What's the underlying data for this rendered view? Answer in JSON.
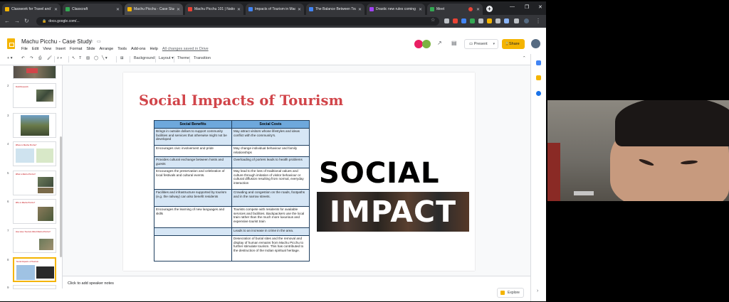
{
  "browser": {
    "tabs": [
      {
        "label": "Classwork for Travel and Tou",
        "color": "#f4b400"
      },
      {
        "label": "Classcraft",
        "color": "#34a853"
      },
      {
        "label": "Machu Picchu - Case Stud",
        "color": "#f4b400"
      },
      {
        "label": "Machu Picchu 101 | Nation",
        "color": "#ea4335"
      },
      {
        "label": "Impacts of Tourism in Machu",
        "color": "#4285f4"
      },
      {
        "label": "The Balance Between Touris",
        "color": "#4285f4"
      },
      {
        "label": "Drastic new rules coming fo",
        "color": "#a142f4"
      },
      {
        "label": "Meet",
        "color": "#34a853"
      }
    ],
    "new_tab": "+",
    "url": "docs.google.com/..."
  },
  "app": {
    "doc_title": "Machu Picchu - Case Study",
    "menu": [
      "File",
      "Edit",
      "View",
      "Insert",
      "Format",
      "Slide",
      "Arrange",
      "Tools",
      "Add-ons",
      "Help"
    ],
    "saved_status": "All changes saved in Drive",
    "present_label": "Present",
    "share_label": "Share",
    "toolbar": {
      "background": "Background",
      "layout": "Layout",
      "theme": "Theme",
      "transition": "Transition"
    }
  },
  "filmstrip": {
    "slides": [
      {
        "num": "",
        "title": ""
      },
      {
        "num": "2",
        "title": "Field Research"
      },
      {
        "num": "3",
        "title": ""
      },
      {
        "num": "4",
        "title": "Where is Machu Picchu?"
      },
      {
        "num": "5",
        "title": "What is Machu Picchu?"
      },
      {
        "num": "6",
        "title": "Who is Machu Picchu?"
      },
      {
        "num": "7",
        "title": "How does Tourism Affect Machu Picchu?"
      },
      {
        "num": "8",
        "title": "Social Impacts of Tourism"
      },
      {
        "num": "9",
        "title": ""
      }
    ],
    "selected": "8"
  },
  "slide": {
    "title": "Social Impacts of Tourism",
    "table": {
      "headers": [
        "Social Benefits",
        "Social Costs"
      ],
      "rows": [
        [
          "Brings in outside dollars to support community facilities and services that otherwise might not be developed",
          "May attract visitors whose lifestyles and ideas conflict with the community's."
        ],
        [
          "Encourages civic involvement and pride",
          "May change individual behaviour and family relationships"
        ],
        [
          "Provides cultural exchange between hosts and guests",
          "Overloading of porters leads to health problems"
        ],
        [
          "Encourages the preservation and celebration of local festivals and cultural events.",
          "May lead to the loss of traditional values and culture through imitation of visitor behaviour or cultural diffusion resulting from normal, everyday interaction"
        ],
        [
          "Facilities and infrastructure supported by tourism (e.g. the railway) can also benefit residents",
          "Crowding and congestion on the roads, footpaths and in the narrow streets."
        ],
        [
          "Encourages the learning of new languages and skills",
          "Tourists compete with residents for available services and facilities. Backpackers use the local train rather than the much more luxurious and expensive tourist train"
        ],
        [
          "",
          "Leads to an increase in crime in the area."
        ],
        [
          "",
          "Desecration of burial sites and the removal and display of human remains from Machu Picchu to further stimulate tourism. This has contributed to the destruction of the Indian spiritual heritage."
        ]
      ]
    },
    "art_word1": "SOCIAL",
    "art_word2": "IMPACT"
  },
  "notes": {
    "placeholder": "Click to add speaker notes",
    "explore": "Explore"
  },
  "colors": {
    "title_red": "#d1454a",
    "table_header": "#6ea8dc",
    "accent_yellow": "#f4b400"
  }
}
